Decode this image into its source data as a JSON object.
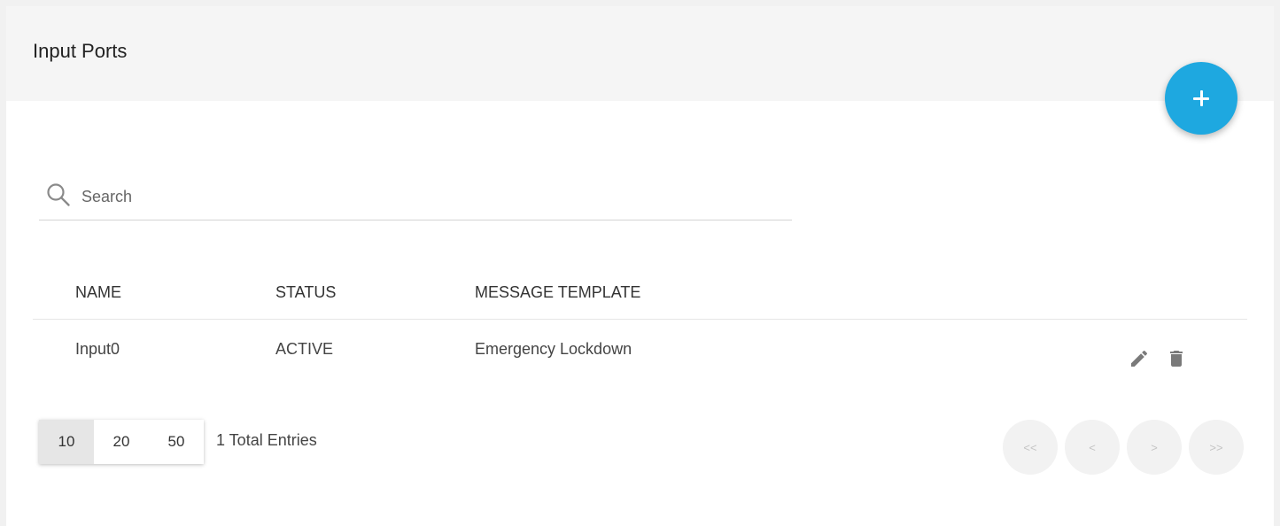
{
  "panel": {
    "title": "Input Ports",
    "add_button_icon": "plus-icon",
    "accent_color": "#1ea8e0"
  },
  "search": {
    "placeholder": "Search",
    "value": "",
    "icon": "search-icon"
  },
  "table": {
    "columns": [
      "NAME",
      "STATUS",
      "MESSAGE TEMPLATE"
    ],
    "rows": [
      {
        "name": "Input0",
        "status": "ACTIVE",
        "message_template": "Emergency Lockdown",
        "actions": [
          "edit-icon",
          "trash-icon"
        ]
      }
    ]
  },
  "pagination": {
    "page_sizes": [
      "10",
      "20",
      "50"
    ],
    "selected_page_size": "10",
    "total_text": "1 Total Entries",
    "nav": {
      "first": "<<",
      "prev": "<",
      "next": ">",
      "last": ">>"
    }
  }
}
